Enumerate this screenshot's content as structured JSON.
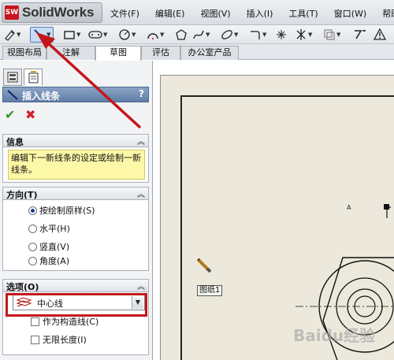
{
  "app": {
    "logo_badge": "SW",
    "logo_text": "SolidWorks"
  },
  "menu": [
    "文件(F)",
    "编辑(E)",
    "视图(V)",
    "插入(I)",
    "工具(T)",
    "窗口(W)",
    "帮助(H)"
  ],
  "tabs": [
    "视图布局",
    "注解",
    "草图",
    "评估",
    "办公室产品"
  ],
  "active_tab": "草图",
  "property_manager": {
    "title": "插入线条",
    "help": "?",
    "ok": "✔",
    "cancel": "✖",
    "info": {
      "heading": "信息",
      "text": "编辑下一新线条的设定或绘制一新线条。"
    },
    "orientation": {
      "heading": "方向(T)",
      "options": [
        "按绘制原样(S)",
        "水平(H)",
        "竖直(V)",
        "角度(A)"
      ],
      "selected_index": 0
    },
    "options": {
      "heading": "选项(O)",
      "line_type": "中心线",
      "checkboxes": [
        "作为构造线(C)",
        "无限长度(I)"
      ]
    }
  },
  "graphics": {
    "cursor_label": "图纸1",
    "tiny_label": "A",
    "watermark": "Baidu经验"
  },
  "colors": {
    "accent_red": "#c4161c",
    "header_blue": "#6b88ae",
    "info_yellow": "#fdf8a8"
  }
}
